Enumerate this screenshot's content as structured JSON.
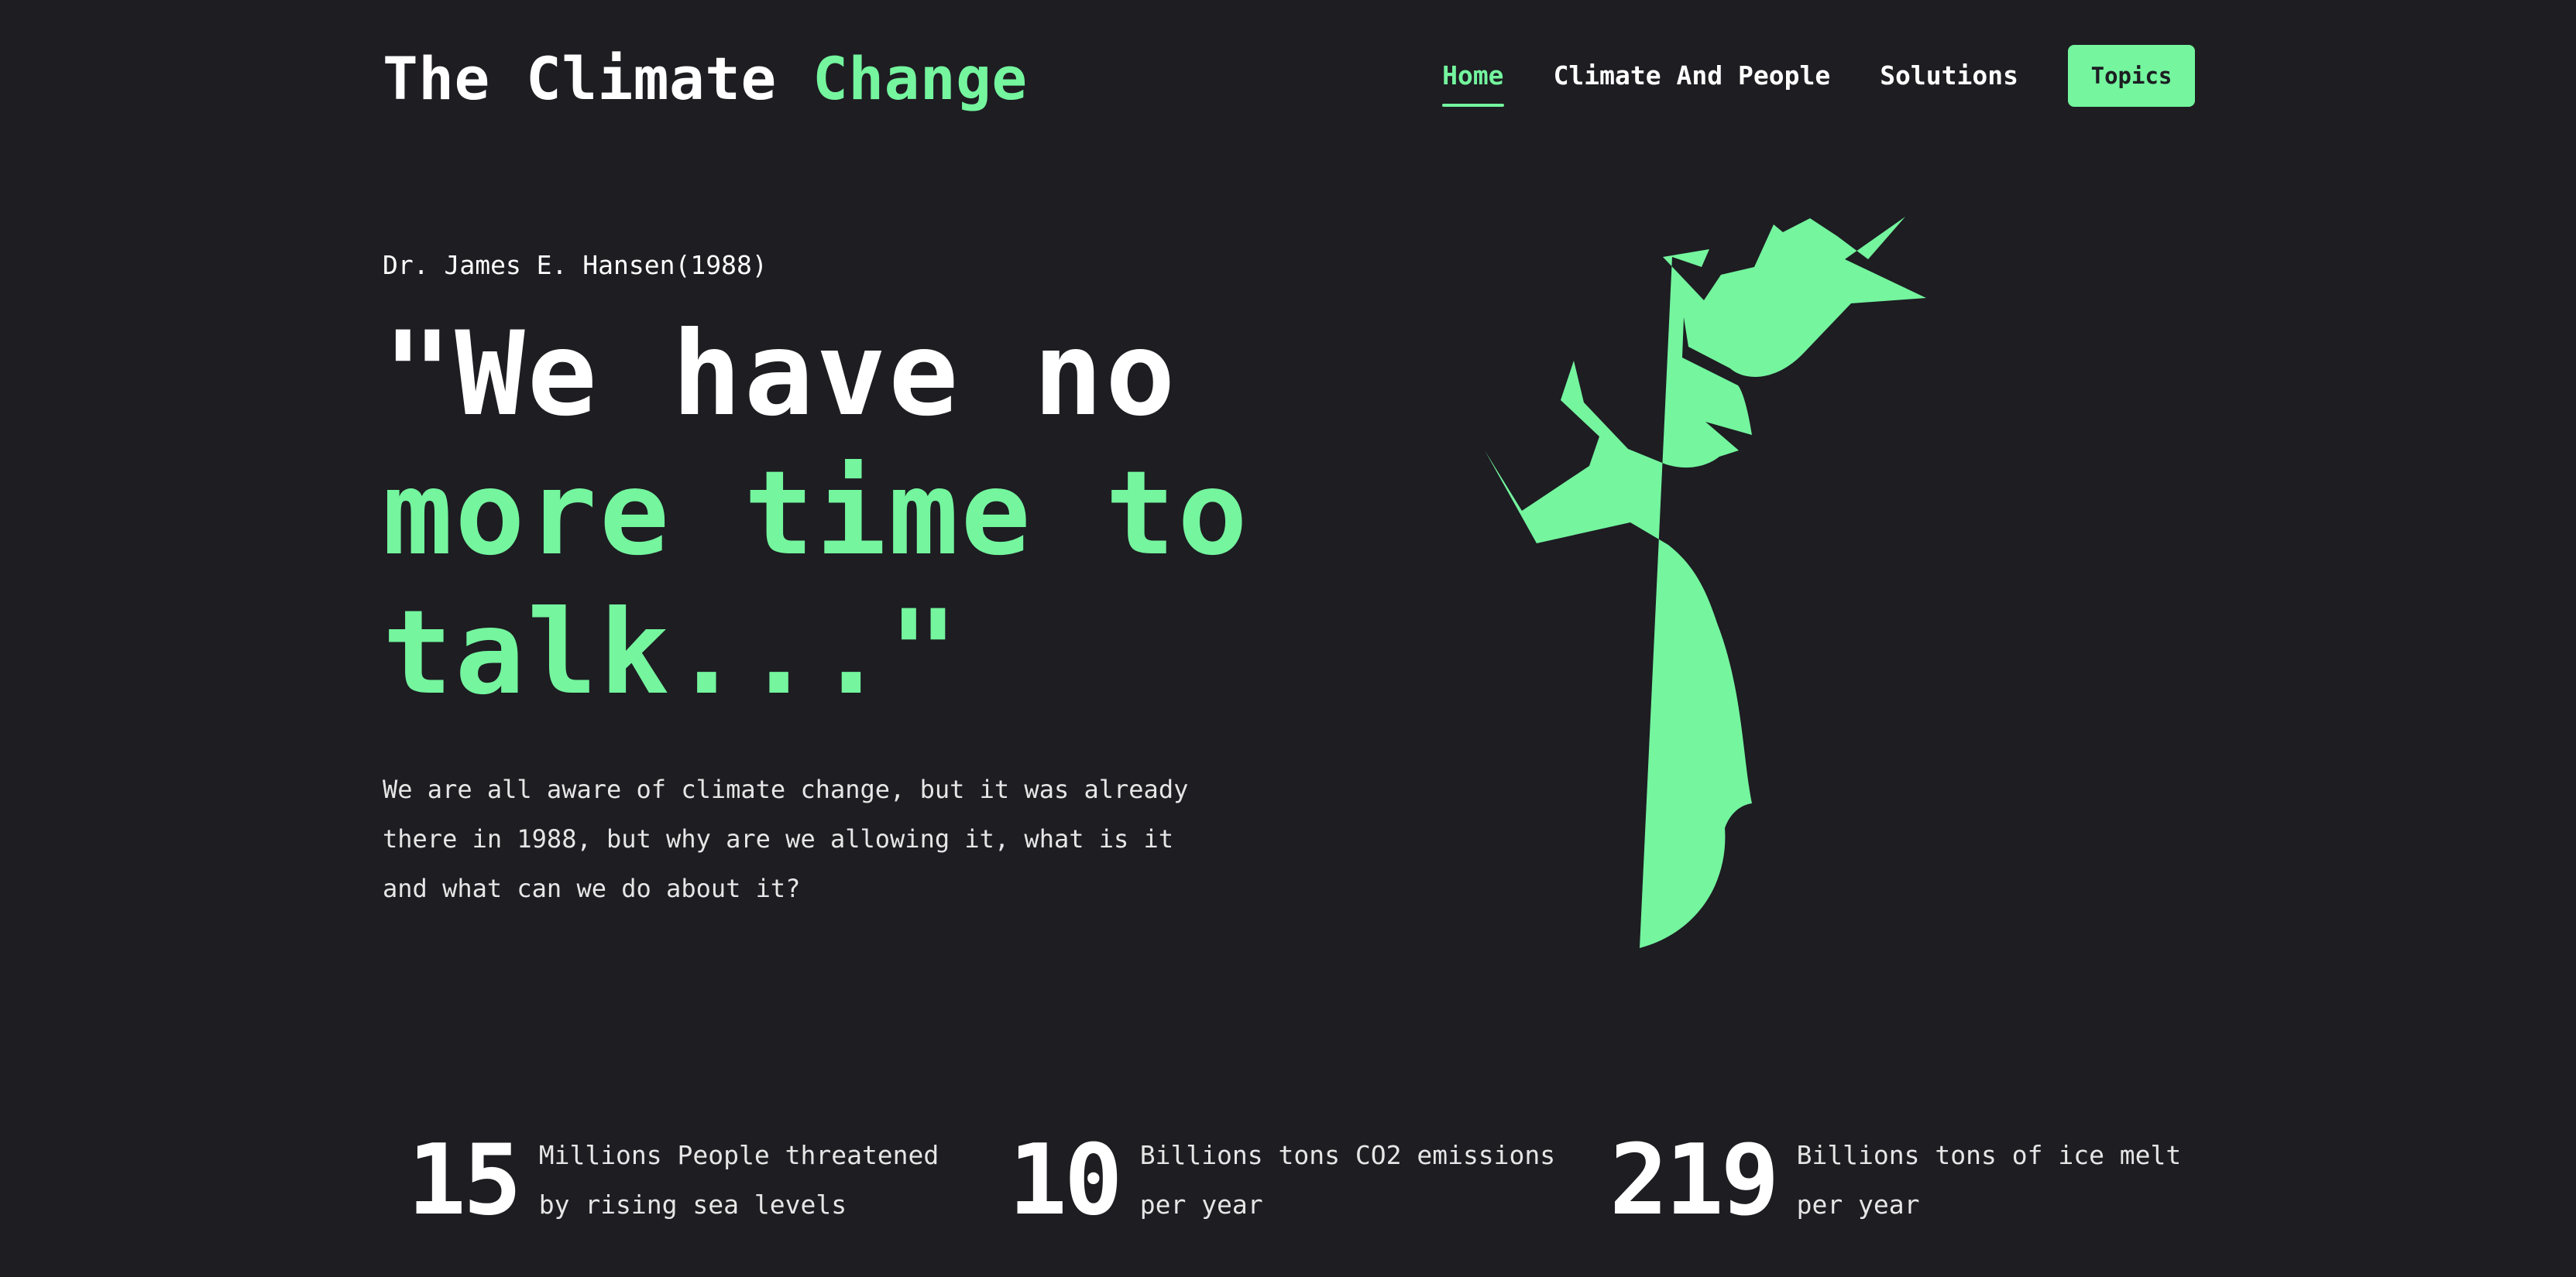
{
  "site": {
    "logo_part1": "The Climate",
    "logo_part2": "Change"
  },
  "nav": {
    "items": [
      {
        "label": "Home",
        "active": true
      },
      {
        "label": "Climate And People",
        "active": false
      },
      {
        "label": "Solutions",
        "active": false
      }
    ],
    "cta_label": "Topics"
  },
  "hero": {
    "author": "Dr. James E. Hansen(1988)",
    "quote_lines": [
      "\"We have no",
      "more time to",
      "talk...\""
    ],
    "description": "We are all aware of climate change, but it was already there in 1988, but why are we allowing it, what is it and what can we do about it?"
  },
  "illustration": {
    "icon": "tree-icon"
  },
  "stats": [
    {
      "number": "15",
      "label_line1": "Millions People threatened",
      "label_line2": "by rising sea levels"
    },
    {
      "number": "10",
      "label_line1": "Billions tons CO2 emissions",
      "label_line2": "per year"
    },
    {
      "number": "219",
      "label_line1": "Billions tons of ice melt",
      "label_line2": "per year"
    }
  ],
  "colors": {
    "background": "#1d1d22",
    "accent": "#74f59e",
    "text": "#ffffff"
  }
}
